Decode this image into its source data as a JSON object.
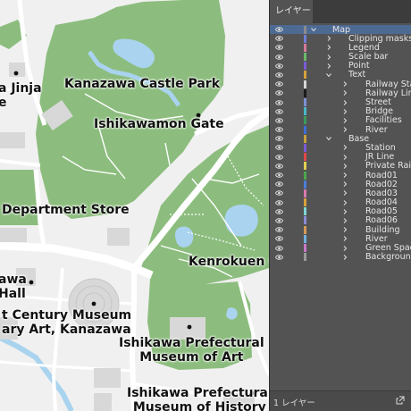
{
  "map": {
    "labels": [
      {
        "id": "jinja",
        "lines": [
          "a Jinja",
          "e"
        ]
      },
      {
        "id": "castle-park",
        "lines": [
          "Kanazawa Castle Park"
        ]
      },
      {
        "id": "gate",
        "lines": [
          "Ishikawamon Gate"
        ]
      },
      {
        "id": "dept-store",
        "lines": [
          "Department Store"
        ]
      },
      {
        "id": "kenrokuen",
        "lines": [
          "Kenrokuen Ga"
        ]
      },
      {
        "id": "hall",
        "lines": [
          "awa",
          "Hall"
        ]
      },
      {
        "id": "museum-21",
        "lines": [
          "t Century Museum",
          "ary Art, Kanazawa"
        ]
      },
      {
        "id": "pref-museum-art",
        "lines": [
          "Ishikawa Prefectural",
          "Museum of Art"
        ]
      },
      {
        "id": "pref-museum-history",
        "lines": [
          "Ishikawa Prefectural",
          "Museum of History"
        ]
      }
    ],
    "colors": {
      "park": "#8cbd7e",
      "water": "#a9d3ee",
      "road": "#ffffff",
      "building": "#d8d8d8",
      "ground": "#f0f0f0"
    }
  },
  "panel": {
    "tab_label": "レイヤー",
    "footer_label": "1 レイヤー",
    "layers": [
      {
        "name": "Map",
        "depth": 0,
        "expanded": true,
        "selected": true,
        "color": "#8b8b8b"
      },
      {
        "name": "Clipping masks",
        "depth": 1,
        "expanded": false,
        "color": "#6f7fd6"
      },
      {
        "name": "Legend",
        "depth": 1,
        "expanded": false,
        "color": "#d67a9a"
      },
      {
        "name": "Scale bar",
        "depth": 1,
        "expanded": false,
        "color": "#6bb86b"
      },
      {
        "name": "Point",
        "depth": 1,
        "expanded": false,
        "color": "#7a5bd6"
      },
      {
        "name": "Text",
        "depth": 1,
        "expanded": true,
        "color": "#d6a23d"
      },
      {
        "name": "Railway Sta",
        "depth": 2,
        "expanded": false,
        "color": "#d6d6d6"
      },
      {
        "name": "Railway Lin",
        "depth": 2,
        "expanded": false,
        "color": "#1a1a1a"
      },
      {
        "name": "Street",
        "depth": 2,
        "expanded": false,
        "color": "#7f8fd6"
      },
      {
        "name": "Bridge",
        "depth": 2,
        "expanded": false,
        "color": "#4ab8c8"
      },
      {
        "name": "Facilities",
        "depth": 2,
        "expanded": false,
        "color": "#3d9a5c"
      },
      {
        "name": "River",
        "depth": 2,
        "expanded": false,
        "color": "#3d6fd6"
      },
      {
        "name": "Base",
        "depth": 1,
        "expanded": true,
        "color": "#c8a03d"
      },
      {
        "name": "Station",
        "depth": 2,
        "expanded": false,
        "color": "#7a5bd6"
      },
      {
        "name": "JR Line",
        "depth": 2,
        "expanded": false,
        "color": "#e04848"
      },
      {
        "name": "Private Rai",
        "depth": 2,
        "expanded": false,
        "color": "#e0d050"
      },
      {
        "name": "Road01",
        "depth": 2,
        "expanded": false,
        "color": "#4aa84a"
      },
      {
        "name": "Road02",
        "depth": 2,
        "expanded": false,
        "color": "#4a7fd6"
      },
      {
        "name": "Road03",
        "depth": 2,
        "expanded": false,
        "color": "#d67ab0"
      },
      {
        "name": "Road04",
        "depth": 2,
        "expanded": false,
        "color": "#d6a23d"
      },
      {
        "name": "Road05",
        "depth": 2,
        "expanded": false,
        "color": "#7fd6d6"
      },
      {
        "name": "Road06",
        "depth": 2,
        "expanded": false,
        "color": "#8b8bd6"
      },
      {
        "name": "Building",
        "depth": 2,
        "expanded": false,
        "color": "#d69a5a"
      },
      {
        "name": "River",
        "depth": 2,
        "expanded": false,
        "color": "#6fb0e0"
      },
      {
        "name": "Green Spac",
        "depth": 2,
        "expanded": false,
        "color": "#c878c8"
      },
      {
        "name": "Backgroun",
        "depth": 2,
        "expanded": false,
        "color": "#9a9a9a"
      }
    ]
  }
}
